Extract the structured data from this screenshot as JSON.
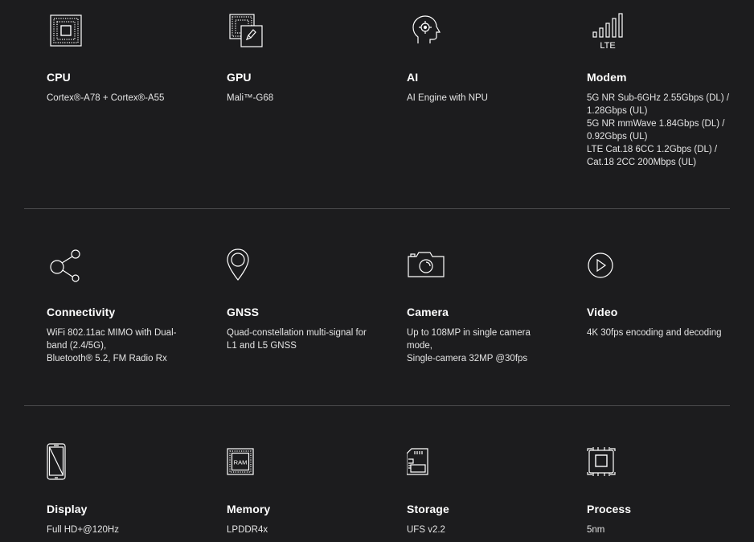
{
  "specs": [
    {
      "key": "cpu",
      "icon": "cpu-chip-icon",
      "title": "CPU",
      "lines": [
        "Cortex®-A78 + Cortex®-A55"
      ]
    },
    {
      "key": "gpu",
      "icon": "gpu-chip-icon",
      "title": "GPU",
      "lines": [
        "Mali™-G68"
      ]
    },
    {
      "key": "ai",
      "icon": "ai-head-icon",
      "title": "AI",
      "lines": [
        "AI Engine with NPU"
      ]
    },
    {
      "key": "modem",
      "icon": "lte-signal-icon",
      "icon_label": "LTE",
      "title": "Modem",
      "lines": [
        "5G NR Sub-6GHz 2.55Gbps (DL) / 1.28Gbps (UL)",
        "5G NR mmWave 1.84Gbps (DL) / 0.92Gbps (UL)",
        "LTE Cat.18 6CC 1.2Gbps (DL) / Cat.18 2CC 200Mbps (UL)"
      ]
    },
    {
      "key": "connectivity",
      "icon": "share-nodes-icon",
      "title": "Connectivity",
      "lines": [
        "WiFi 802.11ac MIMO with Dual-band (2.4/5G),",
        "Bluetooth® 5.2, FM Radio Rx"
      ]
    },
    {
      "key": "gnss",
      "icon": "location-pin-icon",
      "title": "GNSS",
      "lines": [
        "Quad-constellation multi-signal for L1 and L5 GNSS"
      ]
    },
    {
      "key": "camera",
      "icon": "camera-icon",
      "title": "Camera",
      "lines": [
        "Up to 108MP in single camera mode,",
        "Single-camera 32MP @30fps"
      ]
    },
    {
      "key": "video",
      "icon": "play-circle-icon",
      "title": "Video",
      "lines": [
        "4K 30fps encoding and decoding"
      ]
    },
    {
      "key": "display",
      "icon": "phone-display-icon",
      "title": "Display",
      "lines": [
        "Full HD+@120Hz"
      ]
    },
    {
      "key": "memory",
      "icon": "ram-chip-icon",
      "icon_label": "RAM",
      "title": "Memory",
      "lines": [
        "LPDDR4x"
      ]
    },
    {
      "key": "storage",
      "icon": "sd-card-icon",
      "title": "Storage",
      "lines": [
        "UFS v2.2"
      ]
    },
    {
      "key": "process",
      "icon": "process-chip-icon",
      "title": "Process",
      "lines": [
        "5nm"
      ]
    }
  ]
}
